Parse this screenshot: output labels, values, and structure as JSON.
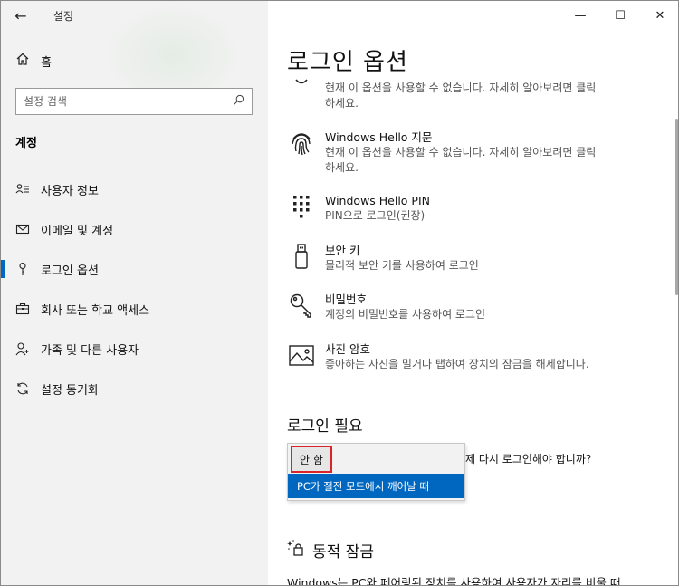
{
  "window": {
    "app_title": "설정",
    "minimize": "—",
    "maximize": "☐",
    "close": "✕"
  },
  "sidebar": {
    "back": "←",
    "home_label": "홈",
    "search_placeholder": "설정 검색",
    "section_title": "계정",
    "items": [
      {
        "label": "사용자 정보",
        "icon": "user-info-icon"
      },
      {
        "label": "이메일 및 계정",
        "icon": "email-icon"
      },
      {
        "label": "로그인 옵션",
        "icon": "key-icon",
        "active": true
      },
      {
        "label": "회사 또는 학교 액세스",
        "icon": "briefcase-icon"
      },
      {
        "label": "가족 및 다른 사용자",
        "icon": "person-add-icon"
      },
      {
        "label": "설정 동기화",
        "icon": "sync-icon"
      }
    ]
  },
  "main": {
    "page_title": "로그인 옵션",
    "options": [
      {
        "title": "",
        "desc1": "현재 이 옵션을 사용할 수 없습니다. 자세히 알아보려면 클릭",
        "desc2": "하세요.",
        "icon": "face-icon"
      },
      {
        "title": "Windows Hello 지문",
        "desc1": "현재 이 옵션을 사용할 수 없습니다. 자세히 알아보려면 클릭",
        "desc2": "하세요.",
        "icon": "fingerprint-icon"
      },
      {
        "title": "Windows Hello PIN",
        "desc1": "PIN으로 로그인(권장)",
        "icon": "pin-keypad-icon"
      },
      {
        "title": "보안 키",
        "desc1": "물리적 보안 키를 사용하여 로그인",
        "icon": "usb-key-icon"
      },
      {
        "title": "비밀번호",
        "desc1": "계정의 비밀번호를 사용하여 로그인",
        "icon": "password-key-icon"
      },
      {
        "title": "사진 암호",
        "desc1": "좋아하는 사진을 밀거나 탭하여 장치의 잠금을 해제합니다.",
        "icon": "picture-icon"
      }
    ],
    "require_signin": {
      "heading": "로그인 필요",
      "question": "제 다시 로그인해야 합니까?",
      "dropdown_options": [
        "안 함",
        "PC가 절전 모드에서 깨어날 때"
      ]
    },
    "dynamic_lock": {
      "heading": "동적 잠금",
      "text": "Windows는 PC와 페어링된 장치를 사용하여 사용자가 자리를 비울 때"
    }
  }
}
